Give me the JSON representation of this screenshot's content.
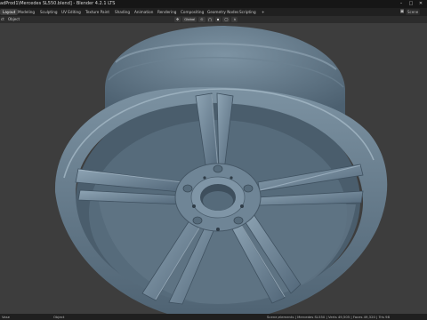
{
  "titlebar": {
    "title": "adProd1\\Mercedes SL550.blend] - Blender 4.2.1 LTS",
    "minimize": "–",
    "maximize": "□",
    "close": "✕"
  },
  "workspace_tabs": [
    {
      "label": "Layout",
      "active": true
    },
    {
      "label": "Modeling"
    },
    {
      "label": "Sculpting"
    },
    {
      "label": "UV Editing"
    },
    {
      "label": "Texture Paint"
    },
    {
      "label": "Shading"
    },
    {
      "label": "Animation"
    },
    {
      "label": "Rendering"
    },
    {
      "label": "Compositing"
    },
    {
      "label": "Geometry Nodes"
    },
    {
      "label": "Scripting"
    },
    {
      "label": "+"
    }
  ],
  "scene_field": "Scene",
  "header": {
    "left_a": "ct",
    "left_b": "Object",
    "transform_orientation": "Global",
    "orientation_icon": "axis-icon",
    "snap_icon": "magnet-icon",
    "proportional_icon": "circle-icon"
  },
  "statusbar": {
    "left": "Vase",
    "mid": "Object",
    "stats": "Scene,elements | Mercedes SL550 | Verts 49,505 | Faces 49,320 | Tris 98"
  },
  "colors": {
    "model_base": "#5e7585",
    "model_light": "#8aa0b0",
    "model_dark": "#3f5160",
    "background": "#3d3d3d"
  }
}
